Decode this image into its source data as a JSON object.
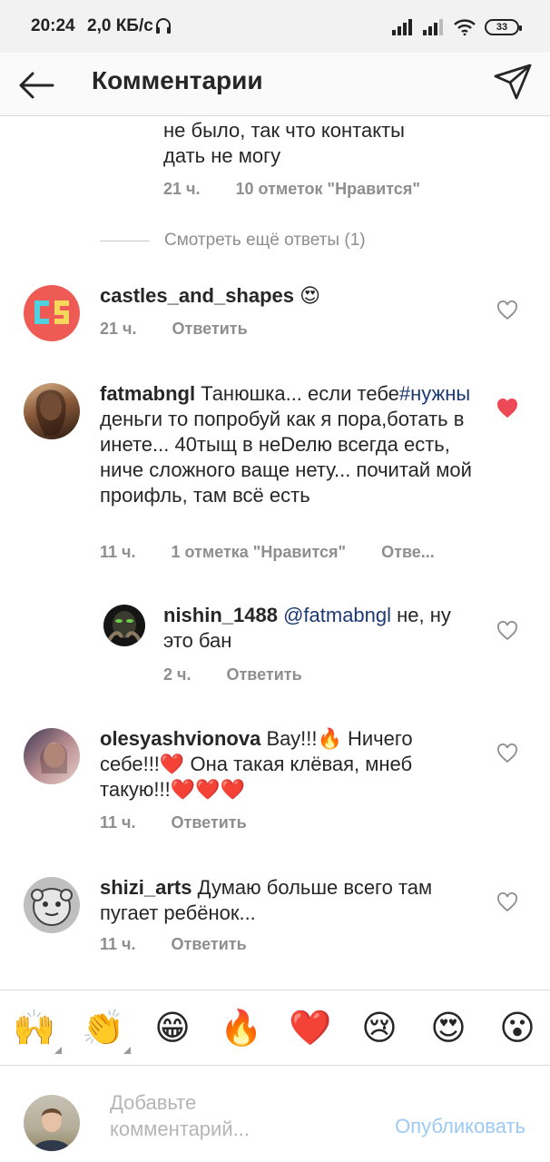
{
  "status_bar": {
    "time": "20:24",
    "speed": "2,0 КБ/с",
    "battery": "33"
  },
  "header": {
    "title": "Комментарии",
    "back_icon": "arrow-left-icon",
    "direct_icon": "paper-plane-icon"
  },
  "comments": {
    "partial": {
      "text_line1": "не было, так что контакты",
      "text_line2": "дать не могу",
      "time": "21 ч.",
      "likes": "10 отметок \"Нравится\""
    },
    "view_more": "Смотреть ещё ответы (1)",
    "items": [
      {
        "username": "castles_and_shapes",
        "text": "",
        "time": "21 ч.",
        "reply": "Ответить",
        "liked": false,
        "emoji": "😍"
      },
      {
        "username": "fatmabngl",
        "text_pre": "Танюшка... если тебе",
        "hashtag": "#нужны",
        "text_post": "деньги то попробуй как я пора,ботать в инете... 40тыщ в неDелю всегда есть, ниче сложного ваще нету... почитай мой проифль, там всё есть",
        "time": "11 ч.",
        "likes": "1 отметка \"Нравится\"",
        "reply": "Отве...",
        "liked": true
      },
      {
        "username": "nishin_1488",
        "mention": "@fatmabngl",
        "text": "не, ну это бан",
        "time": "2 ч.",
        "reply": "Ответить",
        "liked": false
      },
      {
        "username": "olesyashvionova",
        "text_a": "Вау!!!",
        "text_b": "Ничего себе!!!",
        "text_c": "Она такая клёвая, мнеб такую!!!",
        "emoji_fire": "🔥",
        "emoji_heart": "❤️",
        "time": "11 ч.",
        "reply": "Ответить",
        "liked": false
      },
      {
        "username": "shizi_arts",
        "text": "Думаю больше всего там пугает ребёнок...",
        "time": "11 ч.",
        "reply": "Ответить",
        "liked": false
      }
    ]
  },
  "quick_emojis": [
    "🙌",
    "👏",
    "😁",
    "🔥",
    "❤️",
    "😢",
    "😍",
    "😮"
  ],
  "composer": {
    "placeholder_line1": "Добавьте",
    "placeholder_line2": "комментарий...",
    "post_label": "Опубликовать"
  },
  "colors": {
    "liked_heart": "#ed4956",
    "hashtag": "#1b3a73",
    "post_disabled": "#9ccaf5",
    "secondary_text": "#8e8e8e"
  }
}
